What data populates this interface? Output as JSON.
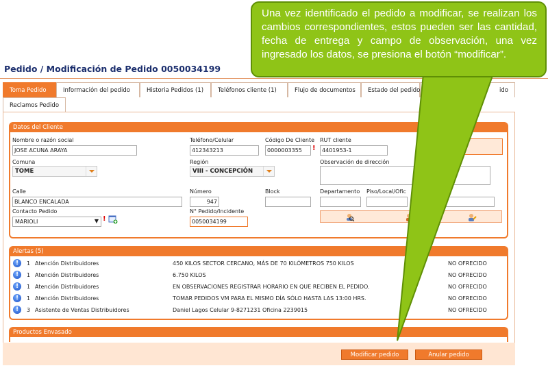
{
  "page_title": "Pedido / Modificación de Pedido 0050034199",
  "tabs_row1": [
    "Toma Pedido",
    "Información del pedido",
    "Historia Pedidos (1)",
    "Teléfonos cliente (1)",
    "Flujo de documentos",
    "Estado del pedido",
    "",
    "ido"
  ],
  "tabs_row2": [
    "Reclamos Pedido"
  ],
  "cliente": {
    "header": "Datos del Cliente",
    "nombre_label": "Nombre o razón social",
    "nombre_value": "JOSE ACUNA ARAYA",
    "telefono_label": "Teléfono/Celular",
    "telefono_value": "412343213",
    "codigo_label": "Código De Cliente",
    "codigo_value": "0000003355",
    "rut_label": "RUT cliente",
    "rut_value": "4401953-1",
    "comuna_label": "Comuna",
    "comuna_value": "TOME",
    "region_label": "Región",
    "region_value": "VIII - CONCEPCIÓN",
    "obs_label": "Observación de dirección",
    "calle_label": "Calle",
    "calle_value": "BLANCO ENCALADA",
    "numero_label": "Número",
    "numero_value": "947",
    "block_label": "Block",
    "depto_label": "Departamento",
    "piso_label": "Piso/Local/Ofic",
    "contacto_label": "Contacto Pedido",
    "contacto_value": "MARIOLI",
    "pedido_label": "N° Pedido/Incidente",
    "pedido_value": "0050034199"
  },
  "alertas": {
    "header": "Alertas (5)",
    "rows": [
      {
        "num": "1",
        "tipo": "Atención Distribuidores",
        "msg": "450 KILOS SECTOR CERCANO, MÁS DE 70 KILÓMETROS 750 KILOS",
        "estado": "NO OFRECIDO"
      },
      {
        "num": "1",
        "tipo": "Atención Distribuidores",
        "msg": "6.750 KILOS",
        "estado": "NO OFRECIDO"
      },
      {
        "num": "1",
        "tipo": "Atención Distribuidores",
        "msg": "EN OBSERVACIONES REGISTRAR HORARIO EN QUE RECIBEN EL PEDIDO.",
        "estado": "NO OFRECIDO"
      },
      {
        "num": "1",
        "tipo": "Atención Distribuidores",
        "msg": "TOMAR PEDIDOS VM PARA EL MISMO DÍA SÓLO HASTA LAS 13:00 HRS.",
        "estado": "NO OFRECIDO"
      },
      {
        "num": "3",
        "tipo": "Asistente de Ventas Distribuidores",
        "msg": "Daniel Lagos Celular 9-8271231 Oficina 2239015",
        "estado": "NO OFRECIDO"
      }
    ]
  },
  "productos_header": "Productos Envasado",
  "buttons": {
    "modificar": "Modificar pedido",
    "anular": "Anular pedido"
  },
  "callout_text": "Una vez identificado el pedido a modificar, se realizan los cambios correspondientes, estos pueden ser las cantidad, fecha de entrega y campo de observación, una vez ingresado los datos,  se presiona el botón “modificar”.",
  "colors": {
    "accent": "#f07a2c",
    "title": "#1c2f6e",
    "callout": "#8fc417"
  }
}
